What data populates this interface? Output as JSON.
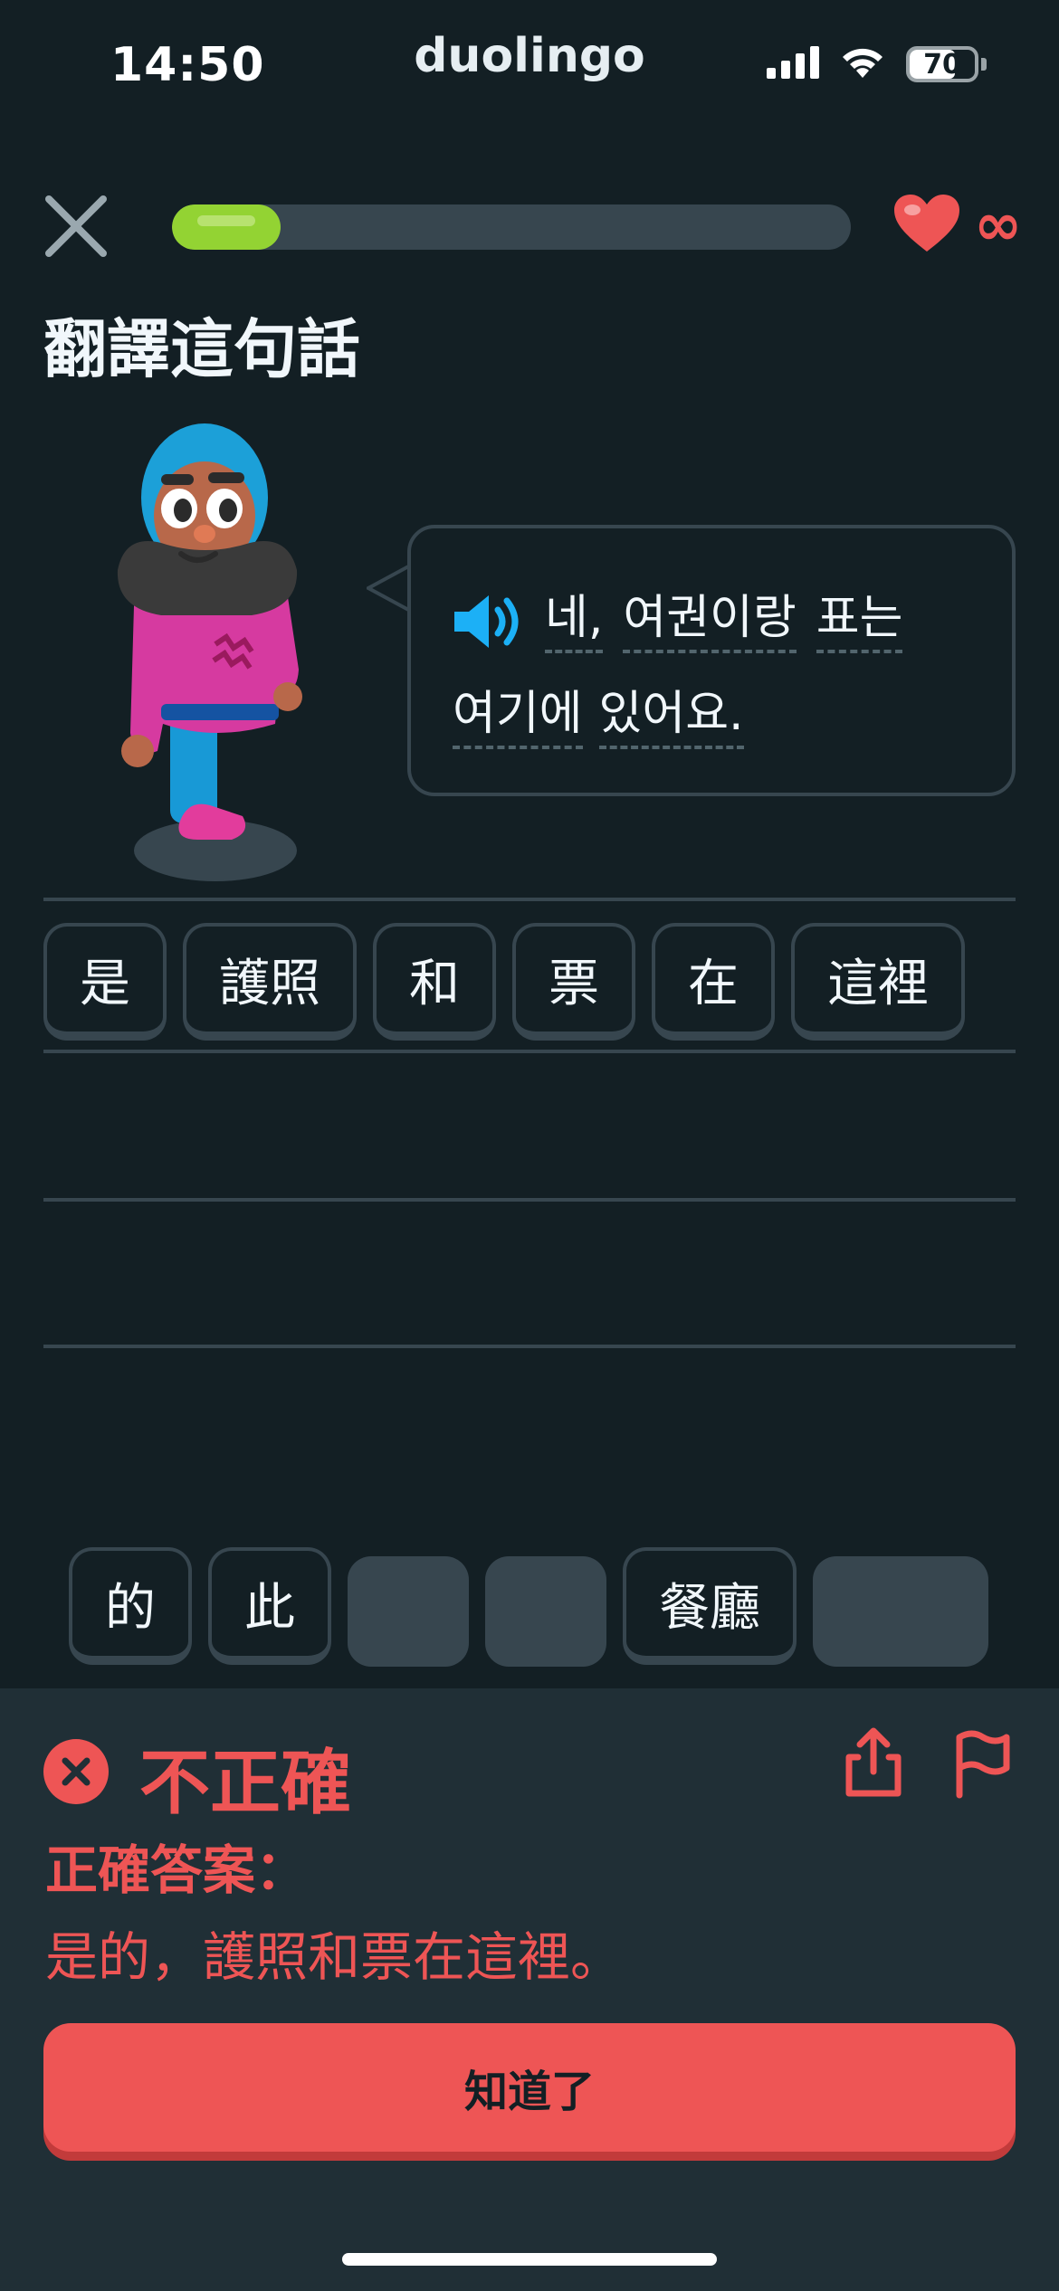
{
  "status_bar": {
    "time": "14:50",
    "brand": "duolingo",
    "battery_level": "70",
    "battery_fraction": 0.7,
    "icons": [
      "signal-icon",
      "wifi-icon",
      "battery-icon"
    ]
  },
  "top_bar": {
    "progress_fraction": 0.16,
    "hearts_value": "∞"
  },
  "prompt": {
    "title": "翻譯這句話"
  },
  "bubble": {
    "line1_words": [
      "네,",
      "여권이랑",
      "표는"
    ],
    "line2_words": [
      "여기에",
      "있어요."
    ]
  },
  "answer_tiles": [
    "是",
    "護照",
    "和",
    "票",
    "在",
    "這裡"
  ],
  "word_bank": {
    "tiles": [
      "的",
      "此",
      "餐廳"
    ]
  },
  "feedback": {
    "title": "不正確",
    "correct_label": "正確答案：",
    "correct_answer": "是的，護照和票在這裡。",
    "continue_label": "知道了"
  },
  "colors": {
    "background": "#131f24",
    "sheet": "#202f36",
    "error_red": "#ee5555",
    "progress_green": "#93d333",
    "tile_border": "#37464f",
    "speaker_blue": "#1cb0f6"
  }
}
